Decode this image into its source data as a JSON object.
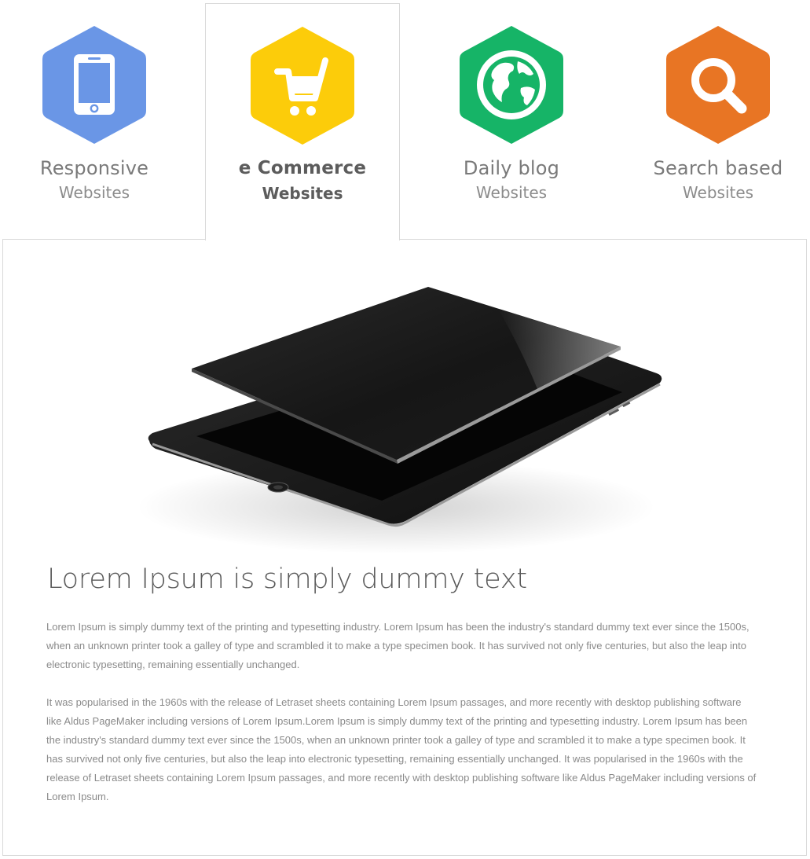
{
  "tabs": [
    {
      "title": "Responsive",
      "subtitle": "Websites",
      "icon": "phone-icon",
      "color": "#6a96e6",
      "active": false
    },
    {
      "title": "e Commerce",
      "subtitle": "Websites",
      "icon": "cart-icon",
      "color": "#fccc0a",
      "active": true
    },
    {
      "title": "Daily blog",
      "subtitle": "Websites",
      "icon": "globe-icon",
      "color": "#16b467",
      "active": false
    },
    {
      "title": "Search based",
      "subtitle": "Websites",
      "icon": "search-icon",
      "color": "#e87524",
      "active": false
    }
  ],
  "content": {
    "title": "Lorem Ipsum is simply dummy text",
    "paragraphs": [
      "Lorem Ipsum is simply dummy text of the printing and typesetting industry. Lorem Ipsum has been the industry's standard dummy text ever since the 1500s, when an unknown printer took a galley of type and scrambled it to make a type specimen book. It has survived not only five centuries, but also the leap into electronic typesetting, remaining essentially unchanged.",
      "It was popularised in the 1960s with the release of Letraset sheets containing Lorem Ipsum passages, and more recently with desktop publishing software like Aldus PageMaker including versions of Lorem Ipsum.Lorem Ipsum is simply dummy text of the printing and typesetting industry. Lorem Ipsum has been the industry's standard dummy text ever since the 1500s, when an unknown printer took a galley of type and scrambled it to make a type specimen book. It has survived not only five centuries, but also the leap into electronic typesetting, remaining essentially unchanged. It was popularised in the 1960s with the release of Letraset sheets containing Lorem Ipsum passages, and more recently with desktop publishing software like Aldus PageMaker including versions of Lorem Ipsum."
    ]
  }
}
